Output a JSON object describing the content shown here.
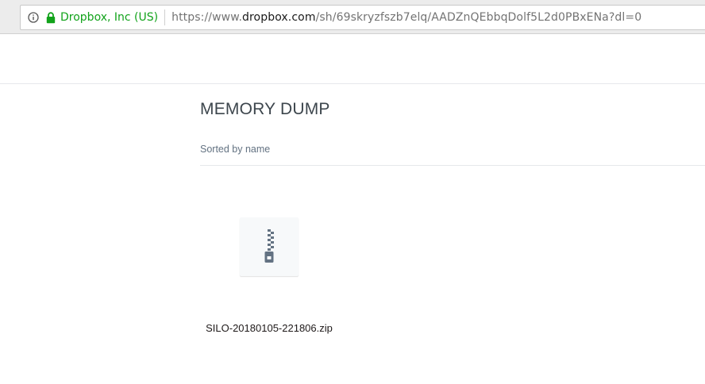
{
  "browser": {
    "identity_label": "Dropbox, Inc (US)",
    "url": {
      "prefix": "https://www.",
      "domain": "dropbox.com",
      "path": "/sh/69skryzfszb7elq/AADZnQEbbqDolf5L2d0PBxENa?dl=0"
    },
    "icons": {
      "info": "info-icon",
      "lock": "lock-icon"
    },
    "colors": {
      "secure_green": "#12a31b"
    }
  },
  "folder": {
    "title": "MEMORY DUMP",
    "sort_label": "Sorted by name"
  },
  "files": [
    {
      "name": "SILO-20180105-221806.zip",
      "icon": "zip-file-icon"
    }
  ]
}
